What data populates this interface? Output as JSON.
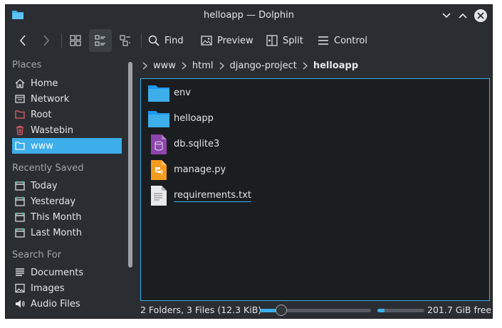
{
  "window": {
    "title": "helloapp — Dolphin"
  },
  "toolbar": {
    "find_label": "Find",
    "preview_label": "Preview",
    "split_label": "Split",
    "control_label": "Control"
  },
  "sidebar": {
    "places_header": "Places",
    "places": [
      {
        "label": "Home",
        "icon": "home-icon"
      },
      {
        "label": "Network",
        "icon": "network-icon"
      },
      {
        "label": "Root",
        "icon": "folder-red-icon"
      },
      {
        "label": "Wastebin",
        "icon": "trash-icon"
      },
      {
        "label": "www",
        "icon": "folder-icon",
        "selected": true
      }
    ],
    "recent_header": "Recently Saved",
    "recent": [
      {
        "label": "Today",
        "icon": "calendar-icon"
      },
      {
        "label": "Yesterday",
        "icon": "calendar-icon"
      },
      {
        "label": "This Month",
        "icon": "calendar-icon"
      },
      {
        "label": "Last Month",
        "icon": "calendar-icon"
      }
    ],
    "search_header": "Search For",
    "search": [
      {
        "label": "Documents",
        "icon": "documents-icon"
      },
      {
        "label": "Images",
        "icon": "images-icon"
      },
      {
        "label": "Audio Files",
        "icon": "audio-icon"
      }
    ]
  },
  "breadcrumb": [
    "www",
    "html",
    "django-project",
    "helloapp"
  ],
  "files": [
    {
      "name": "env",
      "icon": "folder-icon"
    },
    {
      "name": "helloapp",
      "icon": "folder-icon"
    },
    {
      "name": "db.sqlite3",
      "icon": "database-file-icon"
    },
    {
      "name": "manage.py",
      "icon": "python-file-icon"
    },
    {
      "name": "requirements.txt",
      "icon": "text-file-icon"
    }
  ],
  "status": {
    "summary": "2 Folders, 3 Files (12.3 KiB)",
    "zoom_fraction": 0.16,
    "disk_used_fraction": 0.15,
    "free_space": "201.7 GiB free"
  },
  "colors": {
    "accent": "#3daee9",
    "window_bg": "#2a2e32",
    "view_bg": "#1b1e20"
  }
}
